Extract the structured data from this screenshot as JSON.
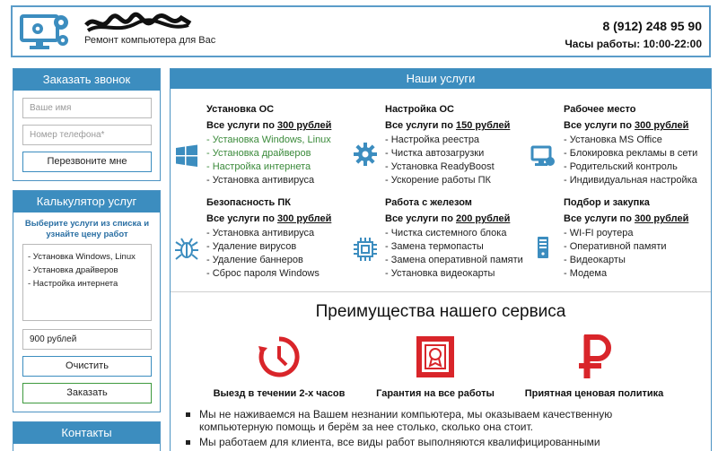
{
  "header": {
    "tagline": "Ремонт компьютера для Вас",
    "phone": "8 (912) 248 95 90",
    "hours": "Часы работы: 10:00-22:00",
    "logo_icon": "monitor-gears-icon"
  },
  "callback": {
    "title": "Заказать звонок",
    "name_placeholder": "Ваше имя",
    "phone_placeholder": "Номер телефона*",
    "submit_label": "Перезвоните мне"
  },
  "calculator": {
    "title": "Калькулятор услуг",
    "hint": "Выберите услуги из списка и узнайте цену работ",
    "selected": [
      "- Установка Windows, Linux",
      "- Установка драйверов",
      "- Настройка интернета"
    ],
    "total": "900 рублей",
    "clear_label": "Очистить",
    "order_label": "Заказать"
  },
  "contacts": {
    "title": "Контакты"
  },
  "services": {
    "title": "Наши услуги",
    "groups": [
      {
        "title": "Установка ОС",
        "price_prefix": "Все услуги по ",
        "price": "300 рублей",
        "icon": "windows-icon",
        "items": [
          "- Установка Windows, Linux",
          "- Установка драйверов",
          "- Настройка интернета",
          "- Установка антивируса"
        ]
      },
      {
        "title": "Настройка ОС",
        "price_prefix": "Все услуги по ",
        "price": "150 рублей",
        "icon": "gear-icon",
        "items": [
          "- Настройка реестра",
          "- Чистка автозагрузки",
          "- Установка ReadyBoost",
          "- Ускорение работы ПК"
        ]
      },
      {
        "title": "Рабочее место",
        "price_prefix": "Все услуги по ",
        "price": "300 рублей",
        "icon": "workstation-icon",
        "items": [
          "- Установка MS Office",
          "- Блокировка рекламы в сети",
          "- Родительский контроль",
          "- Индивидуальная настройка"
        ]
      },
      {
        "title": "Безопасность ПК",
        "price_prefix": "Все услуги по ",
        "price": "300 рублей",
        "icon": "bug-icon",
        "items": [
          "- Установка антивируса",
          "- Удаление вирусов",
          "- Удаление баннеров",
          "- Сброс пароля Windows"
        ]
      },
      {
        "title": "Работа с железом",
        "price_prefix": "Все услуги по ",
        "price": "200 рублей",
        "icon": "chip-icon",
        "items": [
          "- Чистка системного блока",
          "- Замена термопасты",
          "- Замена оперативной памяти",
          "- Установка видеокарты"
        ]
      },
      {
        "title": "Подбор и закупка",
        "price_prefix": "Все услуги по ",
        "price": "300 рублей",
        "icon": "server-icon",
        "items": [
          "- WI-FI роутера",
          "- Оперативной памяти",
          "- Видеокарты",
          "- Модема"
        ]
      }
    ]
  },
  "advantages": {
    "title": "Преимущества нашего сервиса",
    "items": [
      {
        "label": "Выезд в течении 2-х часов",
        "icon": "clock-icon"
      },
      {
        "label": "Гарантия на все работы",
        "icon": "certificate-icon"
      },
      {
        "label": "Приятная ценовая политика",
        "icon": "ruble-icon"
      }
    ],
    "bullets": [
      "Мы не наживаемся на Вашем незнании компьютера, мы оказываем качественную компьютерную помощь и берём за нее столько, сколько она стоит.",
      "Мы работаем для клиента, все виды работ выполняются квалифицированными"
    ]
  },
  "colors": {
    "accent": "#3c8dbf",
    "red": "#d9252a",
    "green": "#3a8a3a"
  }
}
